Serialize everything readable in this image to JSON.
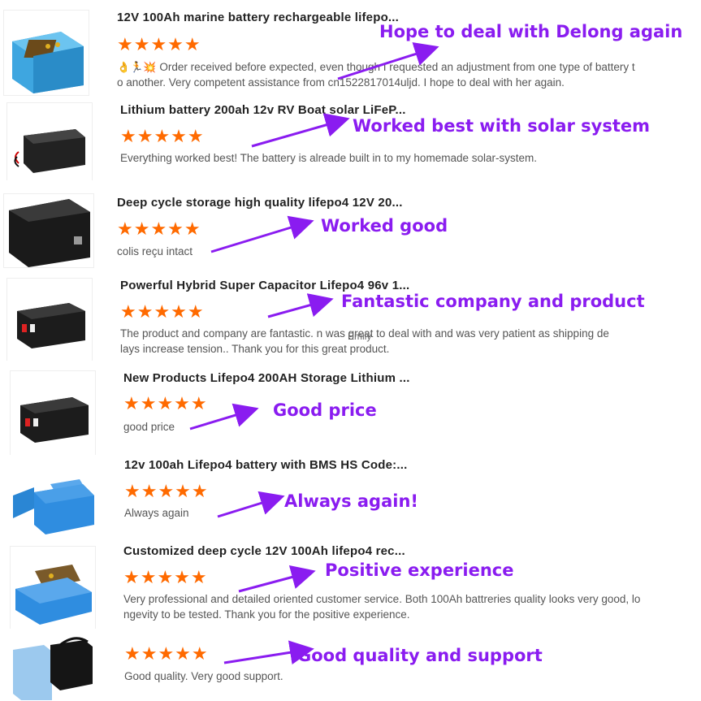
{
  "reviews": [
    {
      "title": "12V 100Ah marine battery rechargeable lifepo...",
      "stars": "★★★★★",
      "emoji": "👌🏃💥",
      "body": [
        "Order received before expected, even though I requested an adjustment from one type of battery t",
        "o another. Very competent assistance from cn1522817014uljd. I hope to deal with her again."
      ],
      "annotation": "Hope to deal with Delong again"
    },
    {
      "title": "Lithium battery 200ah 12v RV Boat solar LiFeP...",
      "stars": "★★★★★",
      "body": [
        "Everything worked best! The battery is alreade built in to my homemade solar-system."
      ],
      "annotation": "Worked best with solar system"
    },
    {
      "title": "Deep cycle storage high quality lifepo4 12V 20...",
      "stars": "★★★★★",
      "body": [
        "colis reçu intact"
      ],
      "annotation": "Worked good"
    },
    {
      "title": "Powerful Hybrid Super Capacitor Lifepo4 96v 1...",
      "stars": "★★★★★",
      "body": [
        "The product and company are fantastic.       n was great to deal with and was very patient as shipping de",
        "lays increase tension..  Thank you for this great product."
      ],
      "overlay": "Emily",
      "annotation": "Fantastic company and product"
    },
    {
      "title": "New Products Lifepo4 200AH Storage Lithium ...",
      "stars": "★★★★★",
      "body": [
        "good price"
      ],
      "annotation": "Good price"
    },
    {
      "title": "12v 100ah Lifepo4 battery with BMS HS Code:...",
      "stars": "★★★★★",
      "body": [
        "Always again"
      ],
      "annotation": "Always again!"
    },
    {
      "title": "Customized deep cycle 12V 100Ah lifepo4 rec...",
      "stars": "★★★★★",
      "body": [
        "Very professional and detailed oriented customer service. Both 100Ah battreries quality looks very good, lo",
        "ngevity to be tested. Thank you for the positive experience."
      ],
      "annotation": "Positive experience"
    },
    {
      "title": "",
      "stars": "★★★★★",
      "body": [
        "Good quality.  Very good support."
      ],
      "annotation": "Good quality and support"
    }
  ],
  "colors": {
    "star": "#ff6a00",
    "annotation": "#8a1cf0"
  },
  "icons": {
    "rating": "star-icon",
    "annotation_pointer": "arrow-icon"
  }
}
